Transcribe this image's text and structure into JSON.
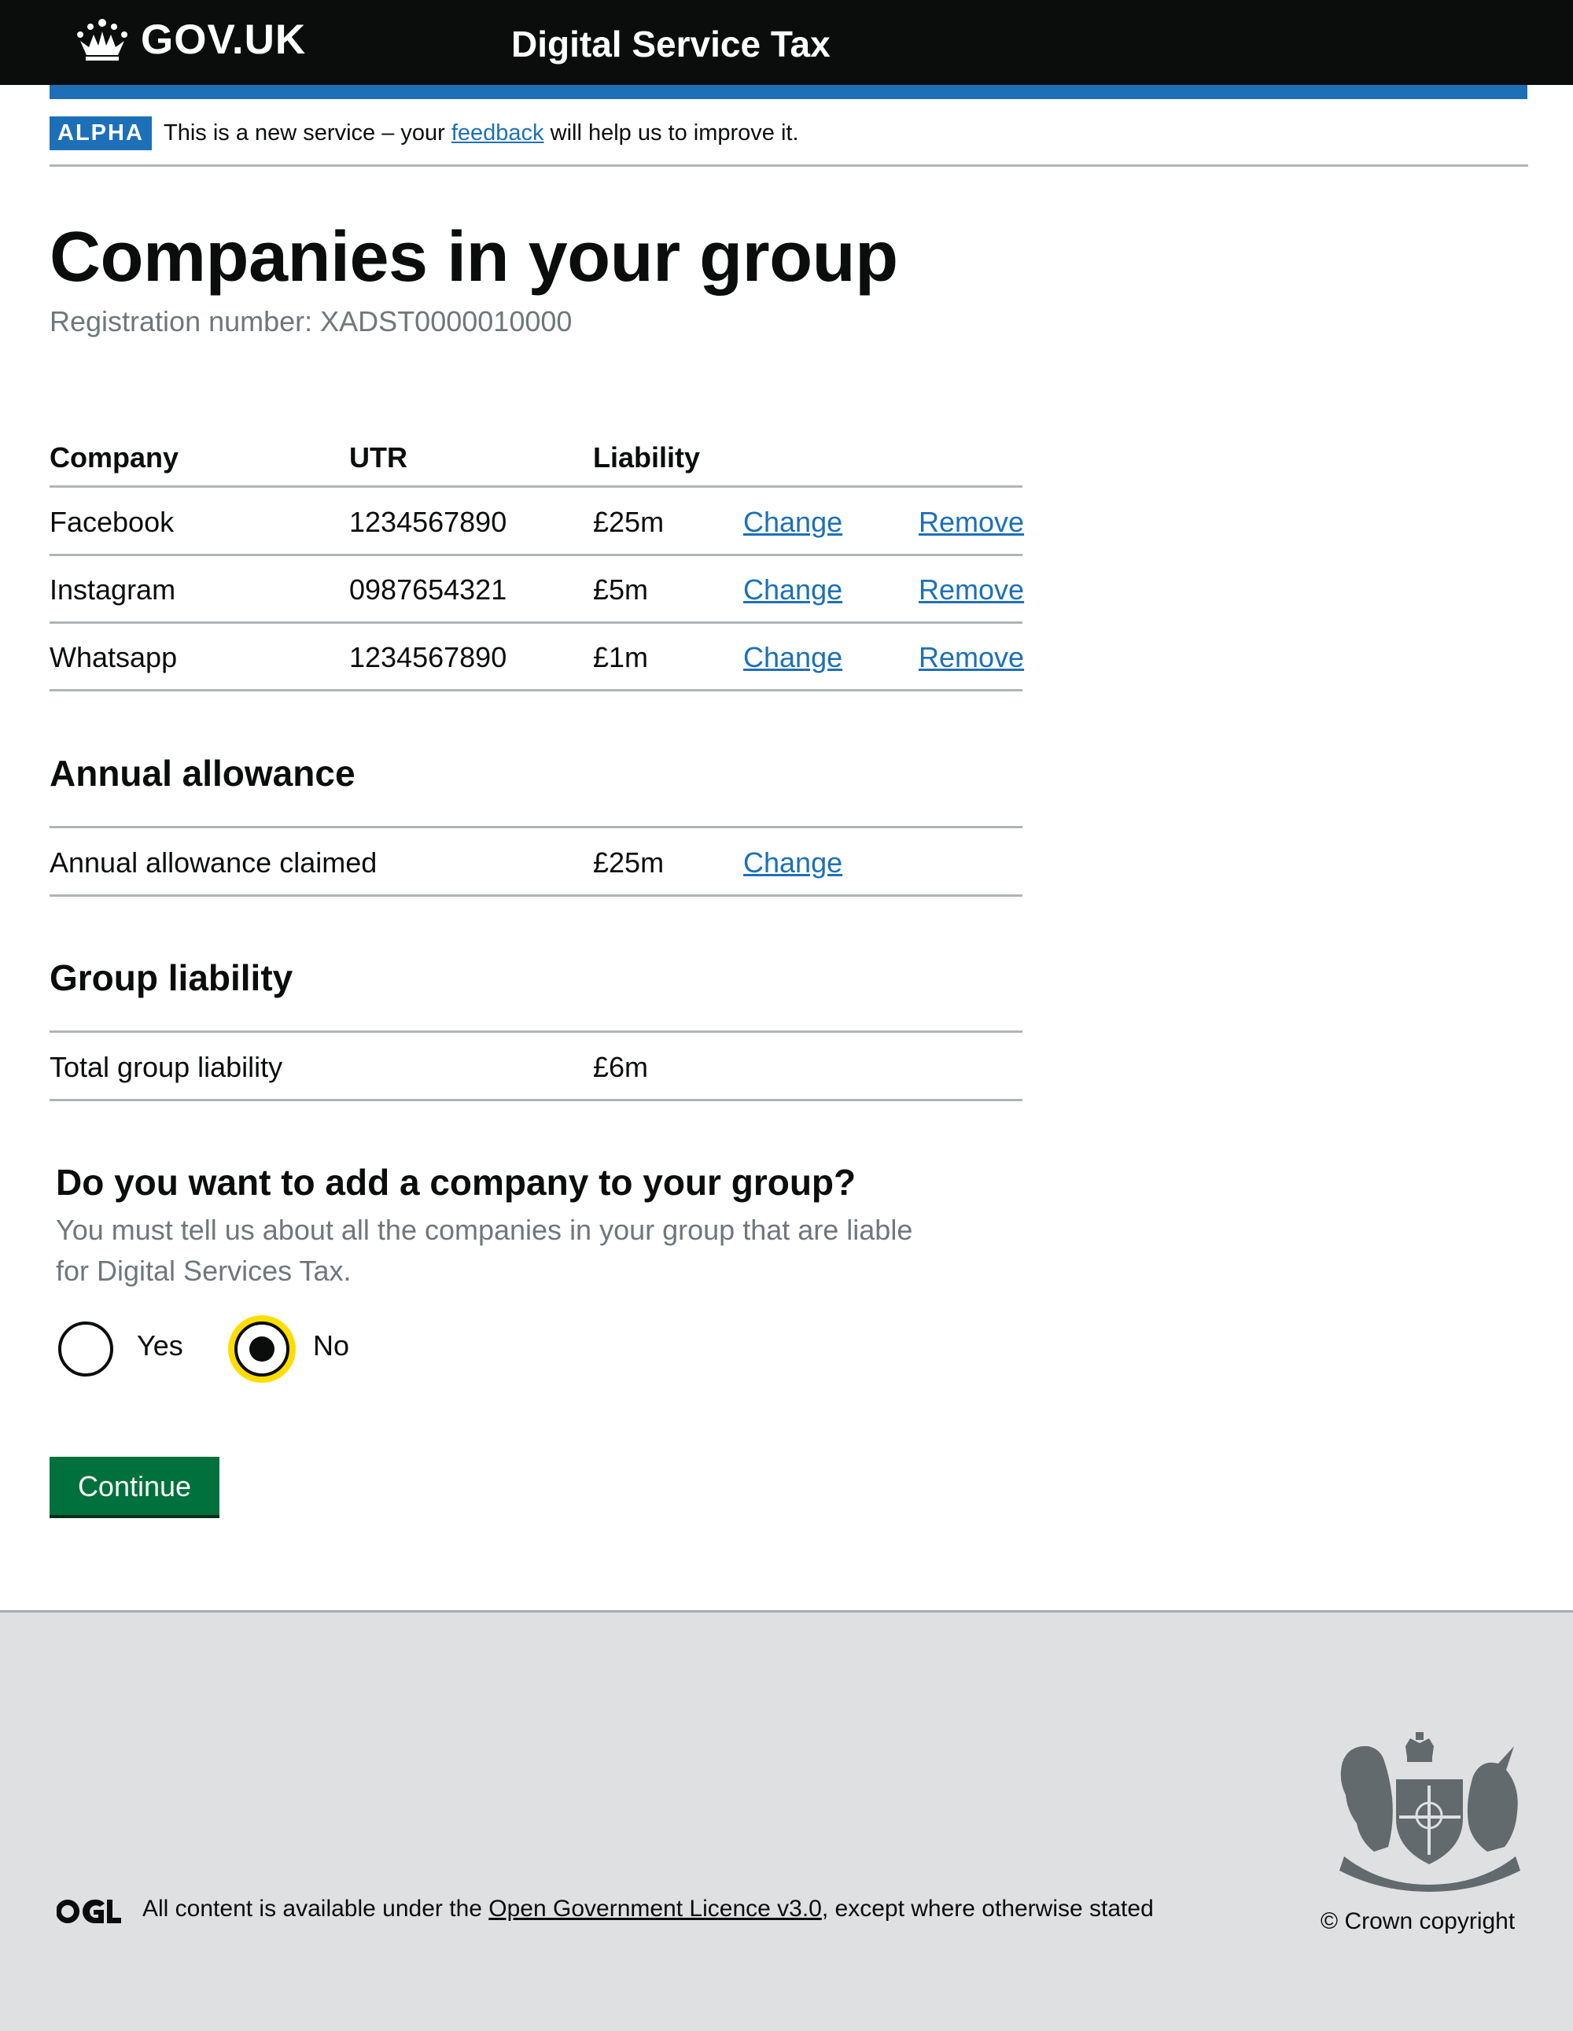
{
  "header": {
    "logotype": "GOV.UK",
    "service_name": "Digital Service Tax"
  },
  "phase_banner": {
    "tag": "ALPHA",
    "text_before": "This is a new service – your ",
    "link_text": "feedback",
    "text_after": " will help us to improve it."
  },
  "page": {
    "title": "Companies in your group",
    "caption": "Registration number: XADST0000010000"
  },
  "companies_table": {
    "headers": [
      "Company",
      "UTR",
      "Liability"
    ],
    "rows": [
      {
        "company": "Facebook",
        "utr": "1234567890",
        "liability": "£25m",
        "change": "Change",
        "remove": "Remove"
      },
      {
        "company": "Instagram",
        "utr": "0987654321",
        "liability": "£5m",
        "change": "Change",
        "remove": "Remove"
      },
      {
        "company": "Whatsapp",
        "utr": "1234567890",
        "liability": "£1m",
        "change": "Change",
        "remove": "Remove"
      }
    ]
  },
  "annual_allowance": {
    "heading": "Annual allowance",
    "label": "Annual allowance claimed",
    "value": "£25m",
    "change": "Change"
  },
  "group_liability": {
    "heading": "Group liability",
    "label": "Total group liability",
    "value": "£6m"
  },
  "question": {
    "legend": "Do you want to add a company to your group?",
    "hint": "You must tell us about all the companies in your group that are liable for Digital Services Tax.",
    "options": [
      {
        "label": "Yes",
        "checked": false
      },
      {
        "label": "No",
        "checked": true
      }
    ]
  },
  "continue_button": "Continue",
  "footer": {
    "ogl_text_before": "All content is available under the ",
    "ogl_link": "Open Government Licence v3.0",
    "ogl_text_after": ", except where otherwise stated",
    "copyright": "© Crown copyright"
  },
  "colors": {
    "black": "#0b0c0c",
    "blue": "#1d70b8",
    "green": "#00703c",
    "focus": "#ffdd00",
    "grey_text": "#6f777b",
    "border": "#b1b4b6",
    "footer_bg": "#dee0e2"
  },
  "icons": {
    "logo": "crown-icon",
    "footer_licence": "ogl-icon",
    "footer_crest": "royal-coat-of-arms-icon"
  }
}
